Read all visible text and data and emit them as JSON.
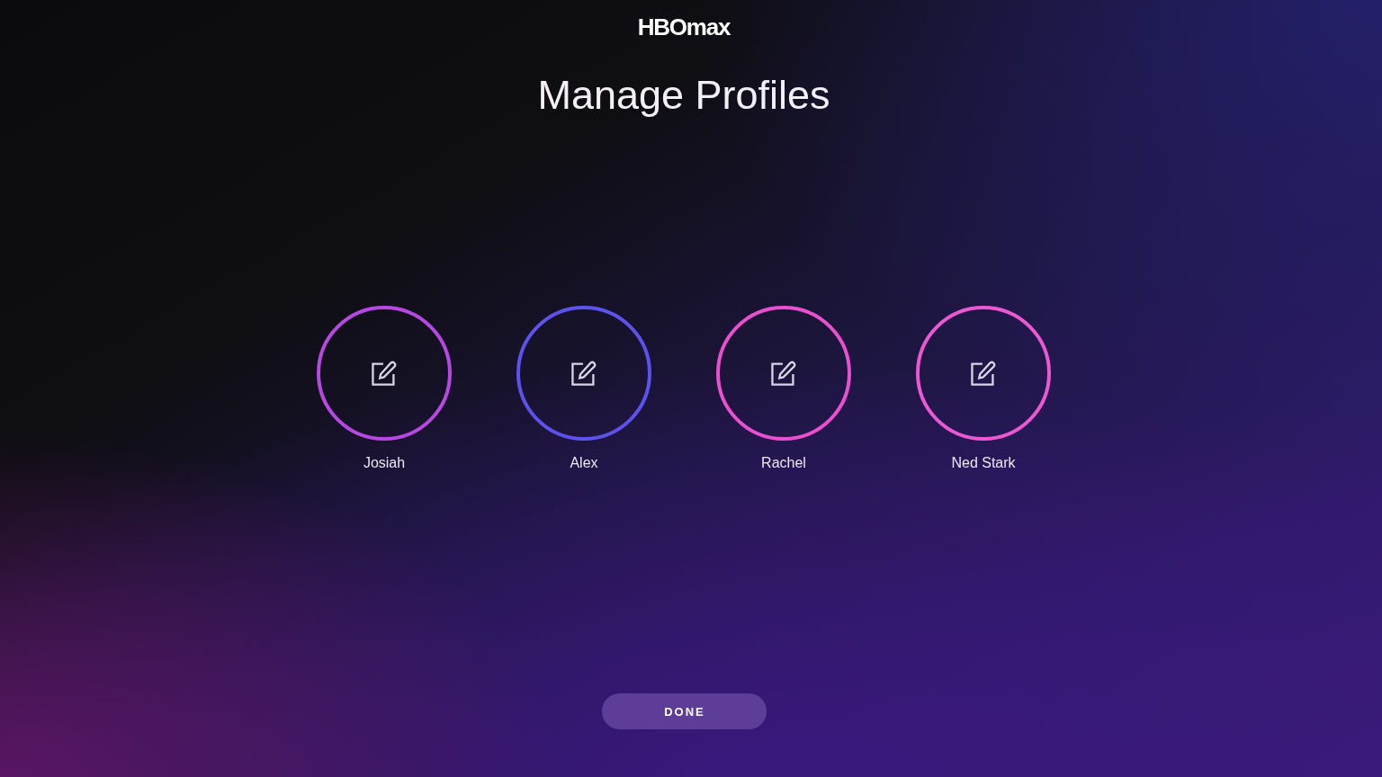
{
  "header": {
    "logo": "HBOmax",
    "title": "Manage Profiles"
  },
  "profiles": [
    {
      "name": "Josiah",
      "color": "#b848e2"
    },
    {
      "name": "Alex",
      "color": "#5d52ee"
    },
    {
      "name": "Rachel",
      "color": "#e850d0"
    },
    {
      "name": "Ned Stark",
      "color": "#ea58d2"
    }
  ],
  "done_button": {
    "label": "DONE"
  }
}
